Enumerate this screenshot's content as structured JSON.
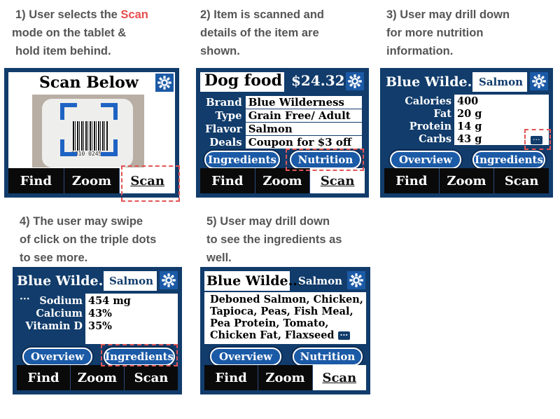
{
  "steps": [
    {
      "caption_a": "1) User selects the ",
      "caption_hl": "Scan",
      "caption_b": " mode on the tablet &",
      "caption_l2": "hold item behind.",
      "title": "Scan Below",
      "barcode_digits": "2310 0245",
      "nav": [
        "Find",
        "Zoom",
        "Scan"
      ]
    },
    {
      "caption_l1": "2) Item is scanned and",
      "caption_l2": "details of the item are",
      "caption_l3": "shown.",
      "title": "Dog food",
      "price": "$24.32",
      "details": [
        {
          "k": "Brand",
          "v": "Blue Wilderness"
        },
        {
          "k": "Type",
          "v": "Grain Free/ Adult"
        },
        {
          "k": "Flavor",
          "v": "Salmon"
        },
        {
          "k": "Deals",
          "v": "Coupon for $3 off"
        }
      ],
      "btn_left": "Ingredients",
      "btn_right": "Nutrition",
      "nav": [
        "Find",
        "Zoom",
        "Scan"
      ]
    },
    {
      "caption_l1": "3) User may drill down",
      "caption_l2": "for more nutrition",
      "caption_l3": "information.",
      "title": "Blue Wilde...",
      "subtitle": "Salmon",
      "nutrition": [
        {
          "k": "Calories",
          "v": "400"
        },
        {
          "k": "Fat",
          "v": "20 g"
        },
        {
          "k": "Protein",
          "v": "14 g"
        },
        {
          "k": "Carbs",
          "v": "43 g"
        }
      ],
      "more": "···",
      "btn_left": "Overview",
      "btn_right": "Ingredients",
      "nav": [
        "Find",
        "Zoom",
        "Scan"
      ]
    },
    {
      "caption_l1": "4) The user may swipe",
      "caption_l2": "of click on the triple dots",
      "caption_l3": "to see more.",
      "title": "Blue Wilde...",
      "subtitle": "Salmon",
      "more": "···",
      "nutrition": [
        {
          "k": "Sodium",
          "v": "454 mg"
        },
        {
          "k": "Calcium",
          "v": "43%"
        },
        {
          "k": "Vitamin D",
          "v": "35%"
        }
      ],
      "btn_left": "Overview",
      "btn_right": "Ingredients",
      "nav": [
        "Find",
        "Zoom",
        "Scan"
      ]
    },
    {
      "caption_l1": "5) User may drill down",
      "caption_l2": "to see the ingredients as",
      "caption_l3": "well.",
      "title": "Blue Wilde...",
      "subtitle": "Salmon",
      "ingredients": [
        "Deboned Salmon, Chicken,",
        "Tapioca, Peas, Fish Meal,",
        "Pea Protein, Tomato,",
        "Chicken Fat, Flaxseed"
      ],
      "more": "···",
      "btn_left": "Overview",
      "btn_right": "Nutrition",
      "nav": [
        "Find",
        "Zoom",
        "Scan"
      ]
    }
  ],
  "colors": {
    "frame": "#113c6b",
    "button": "#1b5aa6",
    "highlight": "#e84d4d",
    "scan_bracket": "#1e63c4"
  }
}
